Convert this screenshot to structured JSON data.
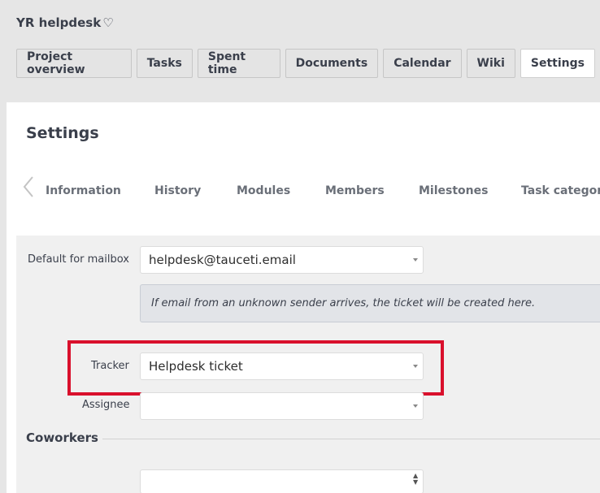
{
  "project": {
    "title": "YR helpdesk",
    "favorite_icon": "♡"
  },
  "tabs": [
    {
      "label": "Project overview",
      "active": false
    },
    {
      "label": "Tasks",
      "active": false
    },
    {
      "label": "Spent time",
      "active": false
    },
    {
      "label": "Documents",
      "active": false
    },
    {
      "label": "Calendar",
      "active": false
    },
    {
      "label": "Wiki",
      "active": false
    },
    {
      "label": "Settings",
      "active": true
    }
  ],
  "settings": {
    "title": "Settings",
    "subtabs": [
      "Information",
      "History",
      "Modules",
      "Members",
      "Milestones",
      "Task categories"
    ]
  },
  "form": {
    "mailbox_label": "Default for mailbox",
    "mailbox_value": "helpdesk@tauceti.email",
    "mailbox_hint": "If email from an unknown sender arrives, the ticket will be created here.",
    "tracker_label": "Tracker",
    "tracker_value": "Helpdesk ticket",
    "assignee_label": "Assignee",
    "assignee_value": "",
    "coworkers_title": "Coworkers",
    "coworkers_value": ""
  },
  "colors": {
    "highlight": "#d9102c",
    "background": "#e6e6e6"
  }
}
